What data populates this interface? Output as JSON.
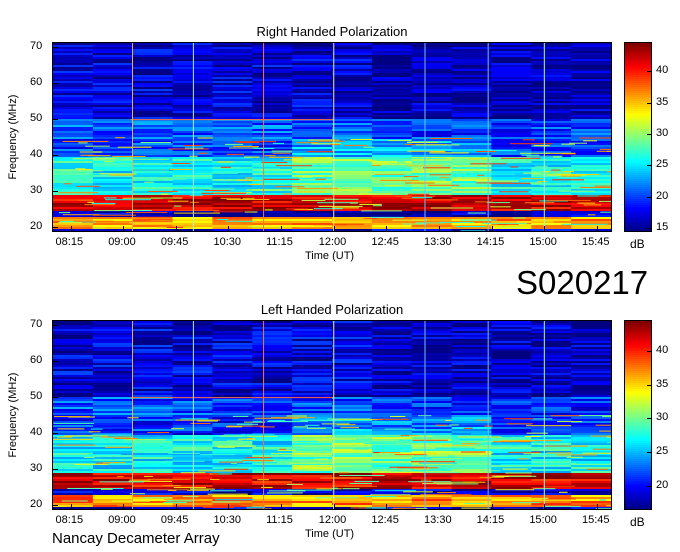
{
  "figure": {
    "identifier": "S020217",
    "caption": "Nancay Decameter Array"
  },
  "chart_data": [
    {
      "type": "heatmap",
      "title": "Right Handed Polarization",
      "xlabel": "Time (UT)",
      "ylabel": "Frequency (MHz)",
      "x_tick_labels": [
        "08:15",
        "09:00",
        "09:45",
        "10:30",
        "11:15",
        "12:00",
        "12:45",
        "13:30",
        "14:15",
        "15:00",
        "15:45"
      ],
      "y_ticks": [
        20,
        30,
        40,
        50,
        60,
        70
      ],
      "ylim": [
        19,
        71
      ],
      "colorbar": {
        "unit": "dB",
        "ticks": [
          15,
          20,
          25,
          30,
          35,
          40
        ],
        "range": [
          14.5,
          44.5
        ]
      },
      "colormap": "jet",
      "vertical_markers_hours": [
        9.133,
        10.0,
        11.0,
        12.0,
        13.3,
        14.2,
        15.0
      ],
      "marker_colors": [
        "#f2b04a",
        "#b0f0c0",
        "#f27a3a",
        "#f7f080",
        "#6ec0ff",
        "#6ec0ff",
        "#a0ffe0"
      ],
      "features": [
        {
          "band_mhz": [
            25,
            29
          ],
          "level_db": 42
        },
        {
          "band_mhz": [
            20,
            23
          ],
          "level_db": 36
        },
        {
          "band_mhz": [
            29,
            40
          ],
          "level_db": 27
        },
        {
          "band_mhz": [
            40,
            50
          ],
          "level_db": 21
        },
        {
          "band_mhz": [
            50,
            70
          ],
          "level_db": 17
        }
      ]
    },
    {
      "type": "heatmap",
      "title": "Left Handed Polarization",
      "xlabel": "Time (UT)",
      "ylabel": "Frequency (MHz)",
      "x_tick_labels": [
        "08:15",
        "09:00",
        "09:45",
        "10:30",
        "11:15",
        "12:00",
        "12:45",
        "13:30",
        "14:15",
        "15:00",
        "15:45"
      ],
      "y_ticks": [
        20,
        30,
        40,
        50,
        60,
        70
      ],
      "ylim": [
        19,
        71
      ],
      "colorbar": {
        "unit": "dB",
        "ticks": [
          20,
          25,
          30,
          35,
          40
        ],
        "range": [
          16.5,
          44.5
        ]
      },
      "colormap": "jet",
      "vertical_markers_hours": [
        9.133,
        10.0,
        11.0,
        12.0,
        13.3,
        14.2,
        15.0
      ],
      "marker_colors": [
        "#f2b04a",
        "#b0f0c0",
        "#f27a3a",
        "#f7f080",
        "#6ec0ff",
        "#6ec0ff",
        "#a0ffe0"
      ],
      "features": [
        {
          "band_mhz": [
            25,
            29
          ],
          "level_db": 42
        },
        {
          "band_mhz": [
            20,
            23
          ],
          "level_db": 37
        },
        {
          "band_mhz": [
            29,
            40
          ],
          "level_db": 28
        },
        {
          "band_mhz": [
            40,
            50
          ],
          "level_db": 22
        },
        {
          "band_mhz": [
            50,
            70
          ],
          "level_db": 19
        }
      ]
    }
  ]
}
